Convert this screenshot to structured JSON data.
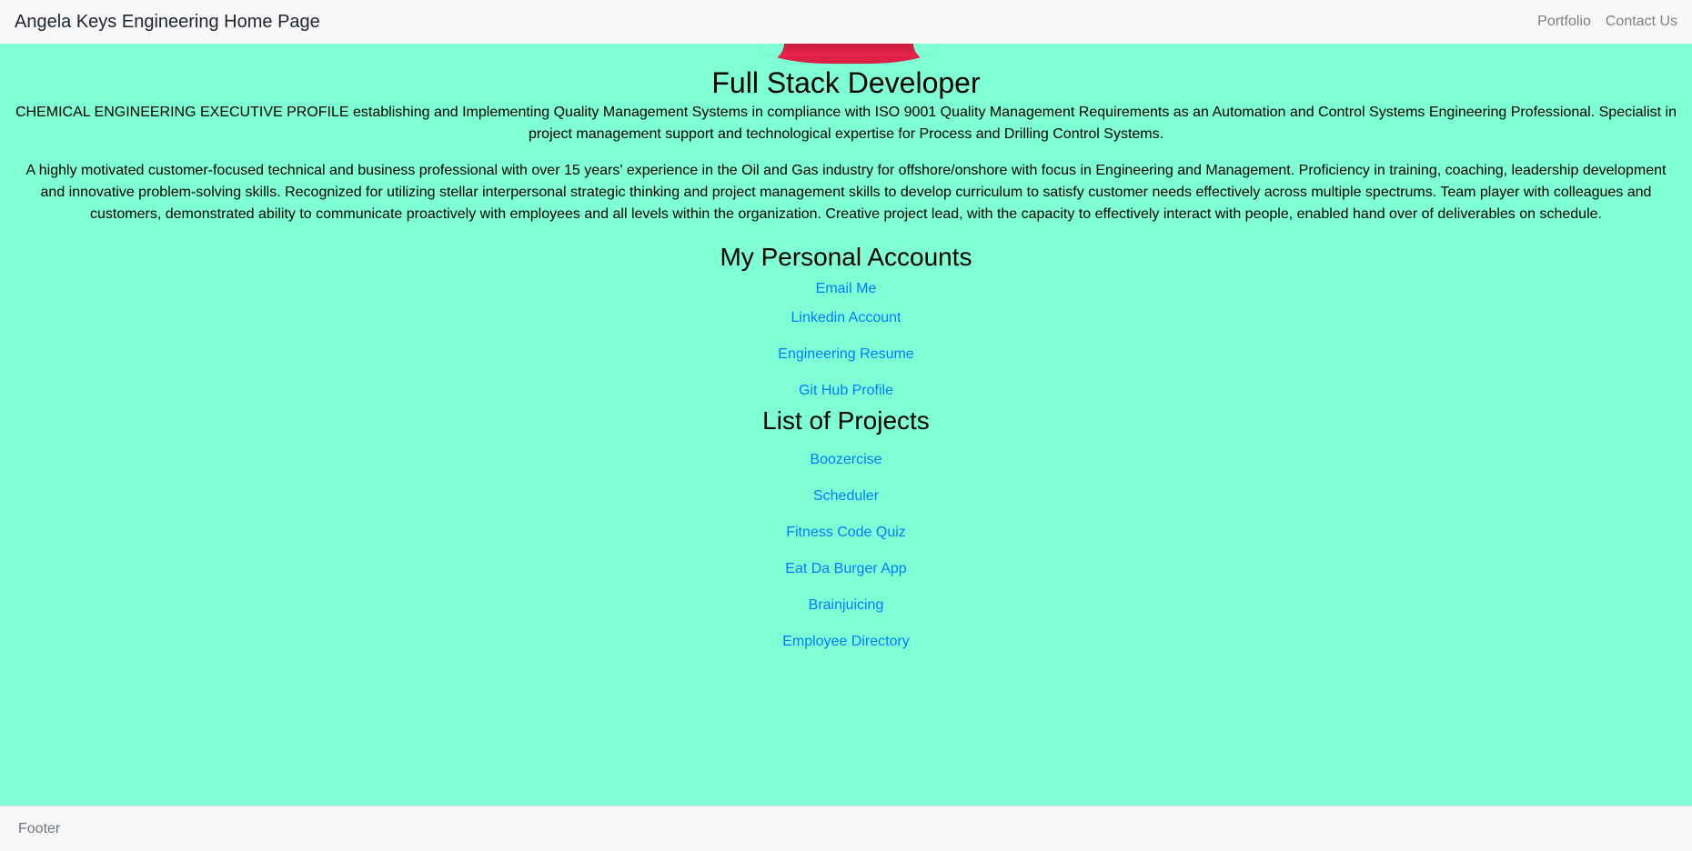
{
  "navbar": {
    "brand": "Angela Keys Engineering Home Page",
    "links": [
      "Portfolio",
      "Contact Us"
    ]
  },
  "main": {
    "title": "Full Stack Developer",
    "paragraphs": [
      "CHEMICAL ENGINEERING EXECUTIVE PROFILE establishing and Implementing Quality Management Systems in compliance with ISO 9001 Quality Management Requirements as an Automation and Control Systems Engineering Professional. Specialist in project management support and technological expertise for Process and Drilling Control Systems.",
      "A highly motivated customer-focused technical and business professional with over 15 years' experience in the Oil and Gas industry for offshore/onshore with focus in Engineering and Management. Proficiency in training, coaching, leadership development and innovative problem-solving skills. Recognized for utilizing stellar interpersonal strategic thinking and project management skills to develop curriculum to satisfy customer needs effectively across multiple spectrums. Team player with colleagues and customers, demonstrated ability to communicate proactively with employees and all levels within the organization. Creative project lead, with the capacity to effectively interact with people, enabled hand over of deliverables on schedule."
    ]
  },
  "accounts": {
    "title": "My Personal Accounts",
    "links": [
      "Email Me",
      "Linkedin Account",
      "Engineering Resume",
      "Git Hub Profile"
    ]
  },
  "projects": {
    "title": "List of Projects",
    "links": [
      "Boozercise",
      "Scheduler",
      "Fitness Code Quiz",
      "Eat Da Burger App",
      "Brainjuicing",
      "Employee Directory"
    ]
  },
  "footer": {
    "text": "Footer"
  },
  "colors": {
    "page_background": "#7fffd4",
    "navbar_background": "#f8f9fa",
    "link": "#007bff",
    "photo_accent": "#e8244a"
  }
}
